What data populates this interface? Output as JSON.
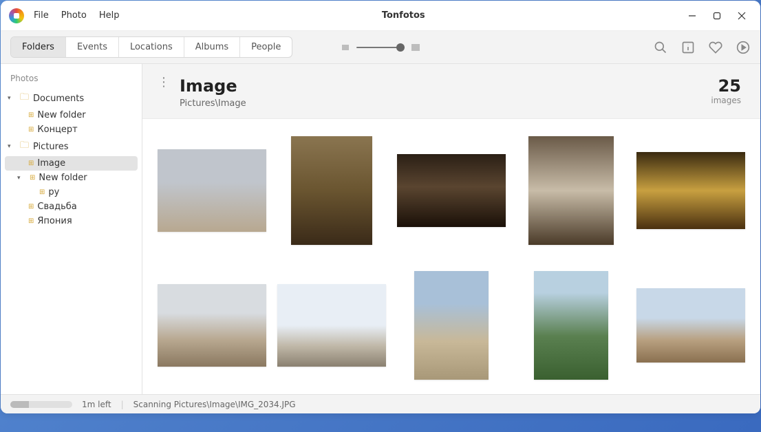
{
  "app": {
    "title": "Tonfotos"
  },
  "menu": {
    "file": "File",
    "photo": "Photo",
    "help": "Help"
  },
  "tabs": {
    "folders": "Folders",
    "events": "Events",
    "locations": "Locations",
    "albums": "Albums",
    "people": "People"
  },
  "sidebar": {
    "title": "Photos",
    "documents": "Documents",
    "documents_children": [
      "New folder",
      "Концерт"
    ],
    "pictures": "Pictures",
    "pictures_image": "Image",
    "pictures_newfolder": "New folder",
    "pictures_py": "py",
    "pictures_svadba": "Свадьба",
    "pictures_japan": "Япония"
  },
  "header": {
    "title": "Image",
    "breadcrumb": "Pictures\\Image",
    "count": "25",
    "count_label": "images"
  },
  "status": {
    "time_left": "1m left",
    "scanning": "Scanning Pictures\\Image\\IMG_2034.JPG"
  }
}
